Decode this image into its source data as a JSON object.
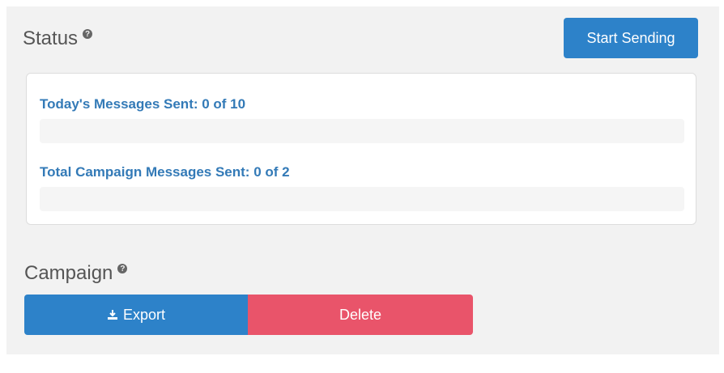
{
  "status": {
    "title": "Status",
    "help_icon": "question-circle-icon",
    "start_button_label": "Start Sending",
    "today": {
      "label": "Today's Messages Sent: 0 of 10",
      "sent": 0,
      "total": 10,
      "progress_fraction": 0
    },
    "campaign_total": {
      "label": "Total Campaign Messages Sent: 0 of 2",
      "sent": 0,
      "total": 2,
      "progress_fraction": 0
    }
  },
  "campaign": {
    "title": "Campaign",
    "help_icon": "question-circle-icon",
    "export_label": "Export",
    "export_icon": "download-icon",
    "delete_label": "Delete"
  },
  "colors": {
    "primary": "#2d82c9",
    "danger": "#e9546a",
    "link": "#337ab7",
    "panel_bg": "#f2f2f2"
  }
}
